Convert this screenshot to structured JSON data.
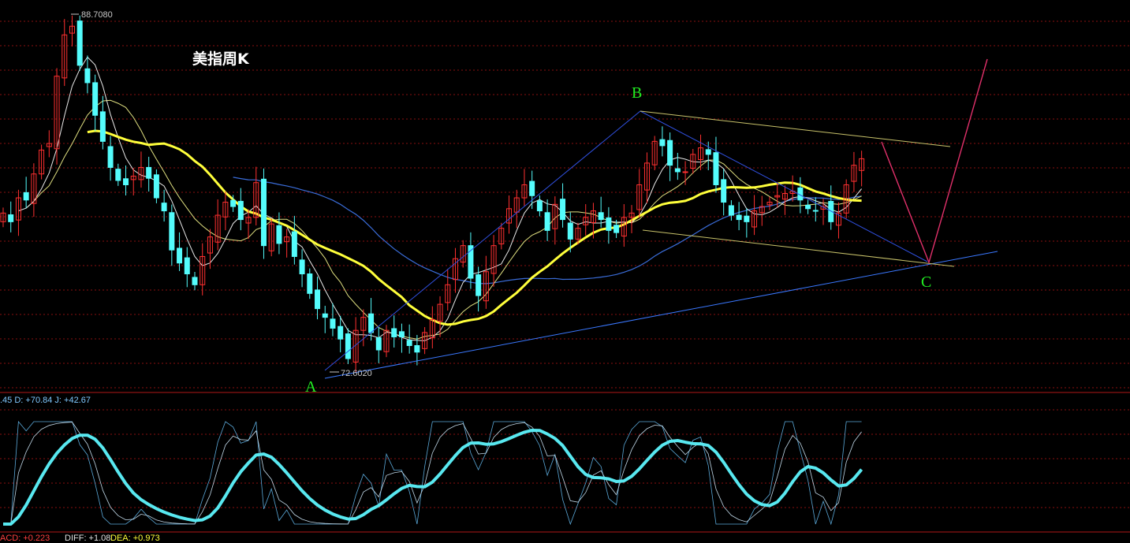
{
  "chart_data": {
    "type": "candlestick",
    "title": "美指周K",
    "price_range": [
      72.0,
      89.5
    ],
    "high_marker": "88.7080",
    "low_marker": "72.6020",
    "high_value": 88.708,
    "low_value": 72.602,
    "wave_labels": [
      "A",
      "B",
      "C"
    ],
    "closes": [
      79.7,
      79.3,
      80.4,
      80.3,
      81.5,
      82.6,
      82.9,
      86.0,
      87.9,
      88.3,
      86.5,
      85.7,
      84.2,
      83.0,
      81.8,
      81.2,
      81.0,
      81.4,
      81.8,
      81.3,
      80.4,
      79.8,
      78.0,
      77.4,
      76.9,
      76.4,
      77.7,
      78.6,
      79.6,
      80.2,
      80.0,
      79.4,
      79.5,
      81.1,
      78.2,
      79.2,
      78.3,
      78.6,
      77.7,
      76.9,
      76.0,
      75.3,
      74.9,
      74.4,
      73.9,
      73.0,
      74.3,
      74.9,
      74.2,
      73.4,
      74.3,
      74.0,
      74.0,
      73.6,
      73.3,
      74.2,
      74.8,
      75.5,
      76.4,
      77.6,
      78.2,
      76.7,
      75.9,
      77.0,
      78.2,
      79.0,
      79.9,
      80.4,
      81.0,
      80.5,
      79.8,
      78.9,
      80.1,
      79.4,
      78.5,
      79.0,
      79.5,
      79.8,
      79.4,
      78.9,
      78.8,
      79.5,
      79.7,
      81.0,
      82.0,
      83.0,
      82.8,
      81.9,
      81.6,
      81.6,
      82.4,
      82.7,
      82.4,
      81.0,
      80.2,
      79.6,
      79.4,
      79.3,
      79.8,
      80.0,
      80.2,
      80.5,
      80.6,
      80.7,
      80.3,
      79.9,
      79.8,
      80.0,
      79.3,
      79.7,
      81.0,
      81.9,
      82.2
    ],
    "ma_yellow": "thick moving average",
    "ma_thin": [
      "white",
      "yellow",
      "blue"
    ],
    "lower_indicator": {
      "kdj_label": ".45  D: +70.84  J: +42.67",
      "macd_label_prefix": "ACD: +0.223",
      "macd_label_diff": "DIFF: +1.08",
      "macd_label_dea": "DEA: +0.973"
    },
    "colors": {
      "up": "#ff3030",
      "down": "#54fcfc",
      "thick_ma": "#ffff3b",
      "thin_ma_white": "#e8e8e8",
      "thin_ma_yellow": "#e0e080",
      "thin_ma_blue": "#3a6cd8",
      "grid": "#8a1010",
      "wave_line": "#3050e0",
      "trend_line": "#3a78ff",
      "channel": "#c8c26a",
      "projection": "#e0306a",
      "kdj_thick": "#58e8f0",
      "kdj_thin": "#5aa8d8"
    }
  }
}
